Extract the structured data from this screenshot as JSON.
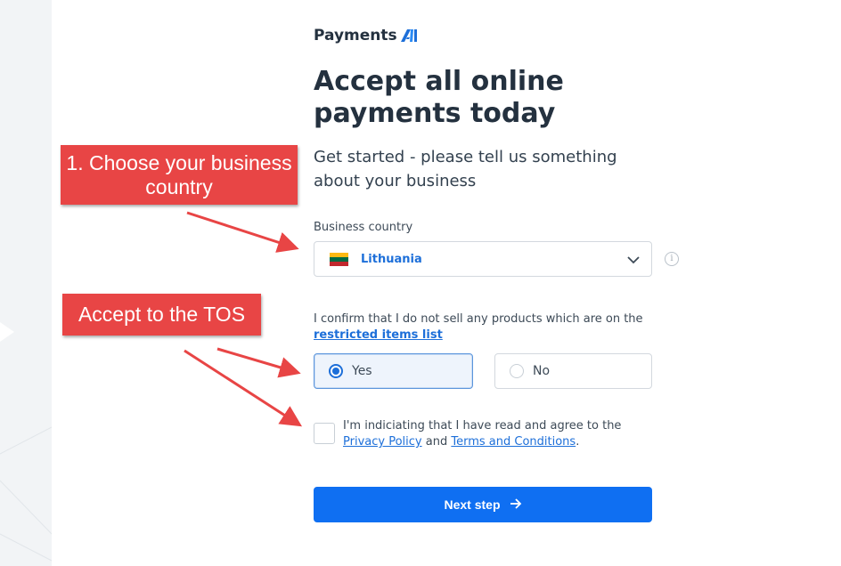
{
  "brand": {
    "name": "Payments",
    "mark": "AI",
    "mark_color": "#1d6fd9"
  },
  "hero": {
    "title_line1": "Accept all online",
    "title_line2": "payments today",
    "subtitle": "Get started - please tell us something about your business"
  },
  "country_field": {
    "label": "Business country",
    "value": "Lithuania",
    "flag_colors": [
      "#fdb913",
      "#006a44",
      "#c1272d"
    ],
    "info_icon": "i"
  },
  "restricted": {
    "text": "I confirm that I do not sell any products which are on the",
    "link": "restricted items list",
    "options": [
      {
        "label": "Yes",
        "selected": true
      },
      {
        "label": "No",
        "selected": false
      }
    ]
  },
  "tos": {
    "text_before": "I'm indiciating that I have read and agree to the",
    "privacy_link": "Privacy Policy",
    "and": "and",
    "terms_link": "Terms and Conditions",
    "end": ".",
    "checked": false
  },
  "next_button": {
    "label": "Next step",
    "icon": "arrow-right-icon",
    "color": "#0f6ff2"
  },
  "annotations": {
    "callout_1": "1. Choose your business country",
    "callout_2": "Accept to the TOS",
    "color": "#e84545"
  }
}
